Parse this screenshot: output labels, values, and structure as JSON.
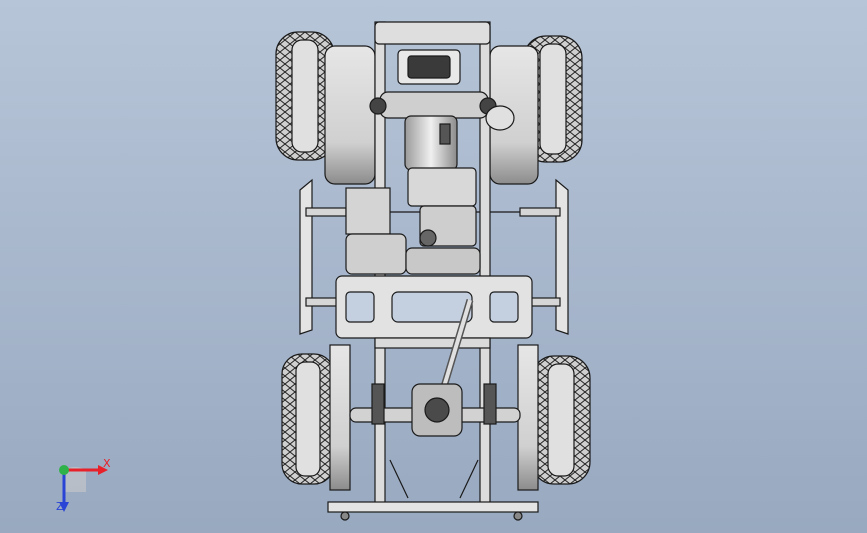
{
  "colors": {
    "background_top": "#b7c5d8",
    "background_bottom": "#98a9c0",
    "part_fill": "#d9d9d9",
    "part_edge": "#1a1a1a",
    "axis_x": "#e8202a",
    "axis_y": "#2fb24a",
    "axis_z": "#2a45d6"
  },
  "triad": {
    "x_label": "X",
    "z_label": "Z",
    "x_color": "#e8202a",
    "z_color": "#2a45d6"
  },
  "model": {
    "icon": "rc-truck-chassis-top-view"
  }
}
